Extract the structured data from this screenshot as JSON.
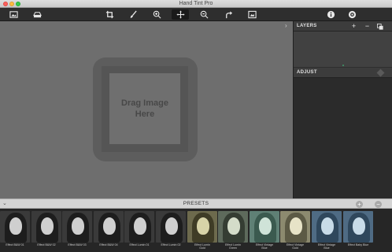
{
  "window": {
    "title": "Hand Tint Pro"
  },
  "toolbar": {
    "buttons": [
      {
        "name": "open-image-icon",
        "active": false
      },
      {
        "name": "save-image-icon",
        "active": false
      },
      {
        "name": "crop-icon",
        "active": false
      },
      {
        "name": "brush-icon",
        "active": false
      },
      {
        "name": "zoom-in-icon",
        "active": false
      },
      {
        "name": "move-icon",
        "active": true
      },
      {
        "name": "zoom-out-icon",
        "active": false
      },
      {
        "name": "redo-icon",
        "active": false
      },
      {
        "name": "compare-icon",
        "active": false
      },
      {
        "name": "info-icon",
        "active": false
      },
      {
        "name": "settings-icon",
        "active": false
      }
    ]
  },
  "canvas": {
    "placeholder": "Drag Image\nHere",
    "collapse_glyph": "›"
  },
  "panel": {
    "layers": {
      "title": "LAYERS",
      "add": "+",
      "remove": "−"
    },
    "adjust": {
      "title": "ADJUST"
    }
  },
  "presets": {
    "title": "PRESETS",
    "collapse_glyph": "⌄",
    "items": [
      {
        "label": "Effect B&W 01",
        "tone": "bw"
      },
      {
        "label": "Effect B&W 02",
        "tone": "bw"
      },
      {
        "label": "Effect B&W 03",
        "tone": "bw"
      },
      {
        "label": "Effect B&W 04",
        "tone": "bw"
      },
      {
        "label": "Effect Lumin 01",
        "tone": "bw"
      },
      {
        "label": "Effect Lumin 02",
        "tone": "bw"
      },
      {
        "label": "Effect Lumin\nGold",
        "tone": "gold"
      },
      {
        "label": "Effect Lumin\nGreen",
        "tone": "green"
      },
      {
        "label": "Effect Vintage\nBlue",
        "tone": "teal"
      },
      {
        "label": "Effect Vintage\nGold",
        "tone": "cream"
      },
      {
        "label": "Effect Vintage\nBlue",
        "tone": "blue"
      },
      {
        "label": "Effect Baby Blue",
        "tone": "blue"
      }
    ]
  },
  "colors": {
    "canvas_bg": "#6e6e6e",
    "panel_bg": "#2f2f2f",
    "toolbar_bg": "#2e2e2e",
    "presets_bar_bg": "#d4d4d4"
  }
}
